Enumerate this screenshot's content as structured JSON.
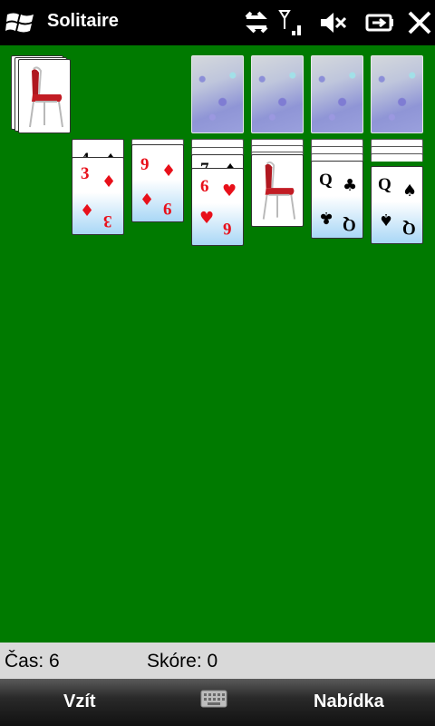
{
  "titlebar": {
    "app_title": "Solitaire",
    "icons": [
      "windows-start-icon",
      "data-connection-icon",
      "signal-strength-icon",
      "speaker-muted-icon",
      "battery-icon",
      "close-icon"
    ]
  },
  "game": {
    "stock_card": "chair-card-back",
    "foundations": [
      "empty",
      "empty",
      "empty",
      "empty"
    ],
    "tableau": [
      {
        "hidden_count": 0,
        "cards": []
      },
      {
        "hidden_count": 1,
        "peek": {
          "rank": "4",
          "suit": "♠"
        },
        "cards": [
          {
            "rank": "3",
            "suit": "♦",
            "color": "red"
          }
        ]
      },
      {
        "hidden_count": 0,
        "cards": [
          {
            "rank": "9",
            "suit": "♦",
            "color": "red"
          }
        ]
      },
      {
        "hidden_count": 2,
        "peek": {
          "rank": "7",
          "suit": "♠"
        },
        "cards": [
          {
            "rank": "6",
            "suit": "♥",
            "color": "red"
          }
        ]
      },
      {
        "hidden_count": 3,
        "cards": [
          {
            "rank": "back",
            "suit": "",
            "color": ""
          }
        ]
      },
      {
        "hidden_count": 3,
        "cards": [
          {
            "rank": "Q",
            "suit": "♣",
            "color": "black"
          }
        ]
      },
      {
        "hidden_count": 3,
        "cards": [
          {
            "rank": "Q",
            "suit": "♠",
            "color": "black"
          }
        ]
      }
    ]
  },
  "status": {
    "time_label": "Čas: 6",
    "score_label": "Skóre: 0"
  },
  "softkeys": {
    "left_label": "Vzít",
    "right_label": "Nabídka"
  },
  "colors": {
    "table": "#007a00",
    "red_suit": "#e8101a",
    "status_bg": "#d9d9d9"
  }
}
